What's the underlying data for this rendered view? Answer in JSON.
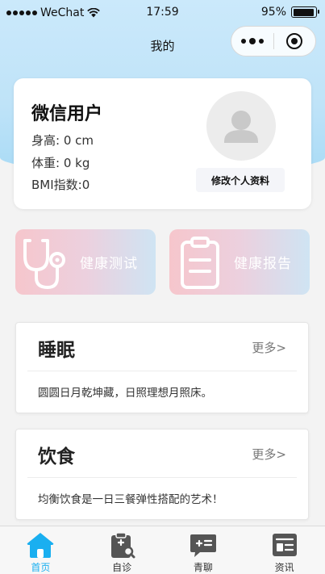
{
  "status_bar": {
    "carrier": "WeChat",
    "time": "17:59",
    "battery": "95%",
    "battery_level": 0.95
  },
  "navbar": {
    "title": "我的"
  },
  "profile": {
    "name": "微信用户",
    "height": "身高: 0 cm",
    "weight": "体重: 0 kg",
    "bmi": "BMI指数:0",
    "edit_button": "修改个人资料"
  },
  "quick_actions": [
    {
      "label": "健康测试",
      "icon": "stethoscope-icon"
    },
    {
      "label": "健康报告",
      "icon": "clipboard-icon"
    }
  ],
  "sections": [
    {
      "title": "睡眠",
      "more": "更多>",
      "text": "圆圆日月乾坤藏，日照理想月照床。"
    },
    {
      "title": "饮食",
      "more": "更多>",
      "text": "均衡饮食是一日三餐弹性搭配的艺术！"
    }
  ],
  "tabbar": [
    {
      "label": "首页",
      "icon": "home-icon",
      "active": true
    },
    {
      "label": "自诊",
      "icon": "self-diagnosis-icon",
      "active": false
    },
    {
      "label": "青聊",
      "icon": "chat-icon",
      "active": false
    },
    {
      "label": "资讯",
      "icon": "news-icon",
      "active": false
    }
  ],
  "colors": {
    "accent": "#1aaff0",
    "hero_bg": "#bfe3f8",
    "tile_pink": "#f6c6cc",
    "tile_blue": "#cfe4f3"
  }
}
